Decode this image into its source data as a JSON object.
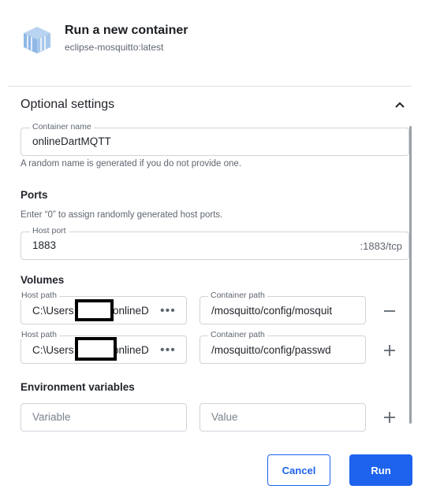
{
  "header": {
    "title": "Run a new container",
    "image": "eclipse-mosquitto:latest",
    "icon": "container-cube-icon"
  },
  "optional": {
    "title": "Optional settings",
    "container_name": {
      "label": "Container name",
      "value": "onlineDartMQTT"
    },
    "name_help": "A random name is generated if you do not provide one."
  },
  "ports": {
    "title": "Ports",
    "help": "Enter “0” to assign randomly generated host ports.",
    "host_port": {
      "label": "Host port",
      "value": "1883",
      "suffix": ":1883/tcp"
    }
  },
  "volumes": {
    "title": "Volumes",
    "rows": [
      {
        "host_label": "Host path",
        "host_prefix": "C:\\Users",
        "host_suffix": "onlineD",
        "container_label": "Container path",
        "container_value": "/mosquitto/config/mosquit"
      },
      {
        "host_label": "Host path",
        "host_prefix": "C:\\Users",
        "host_suffix": "onlineD",
        "container_label": "Container path",
        "container_value": "/mosquitto/config/passwd"
      }
    ]
  },
  "env": {
    "title": "Environment variables",
    "variable_placeholder": "Variable",
    "value_placeholder": "Value"
  },
  "buttons": {
    "cancel": "Cancel",
    "run": "Run"
  },
  "colors": {
    "accent": "#1d63ed",
    "cube": "#8fb8e6"
  }
}
